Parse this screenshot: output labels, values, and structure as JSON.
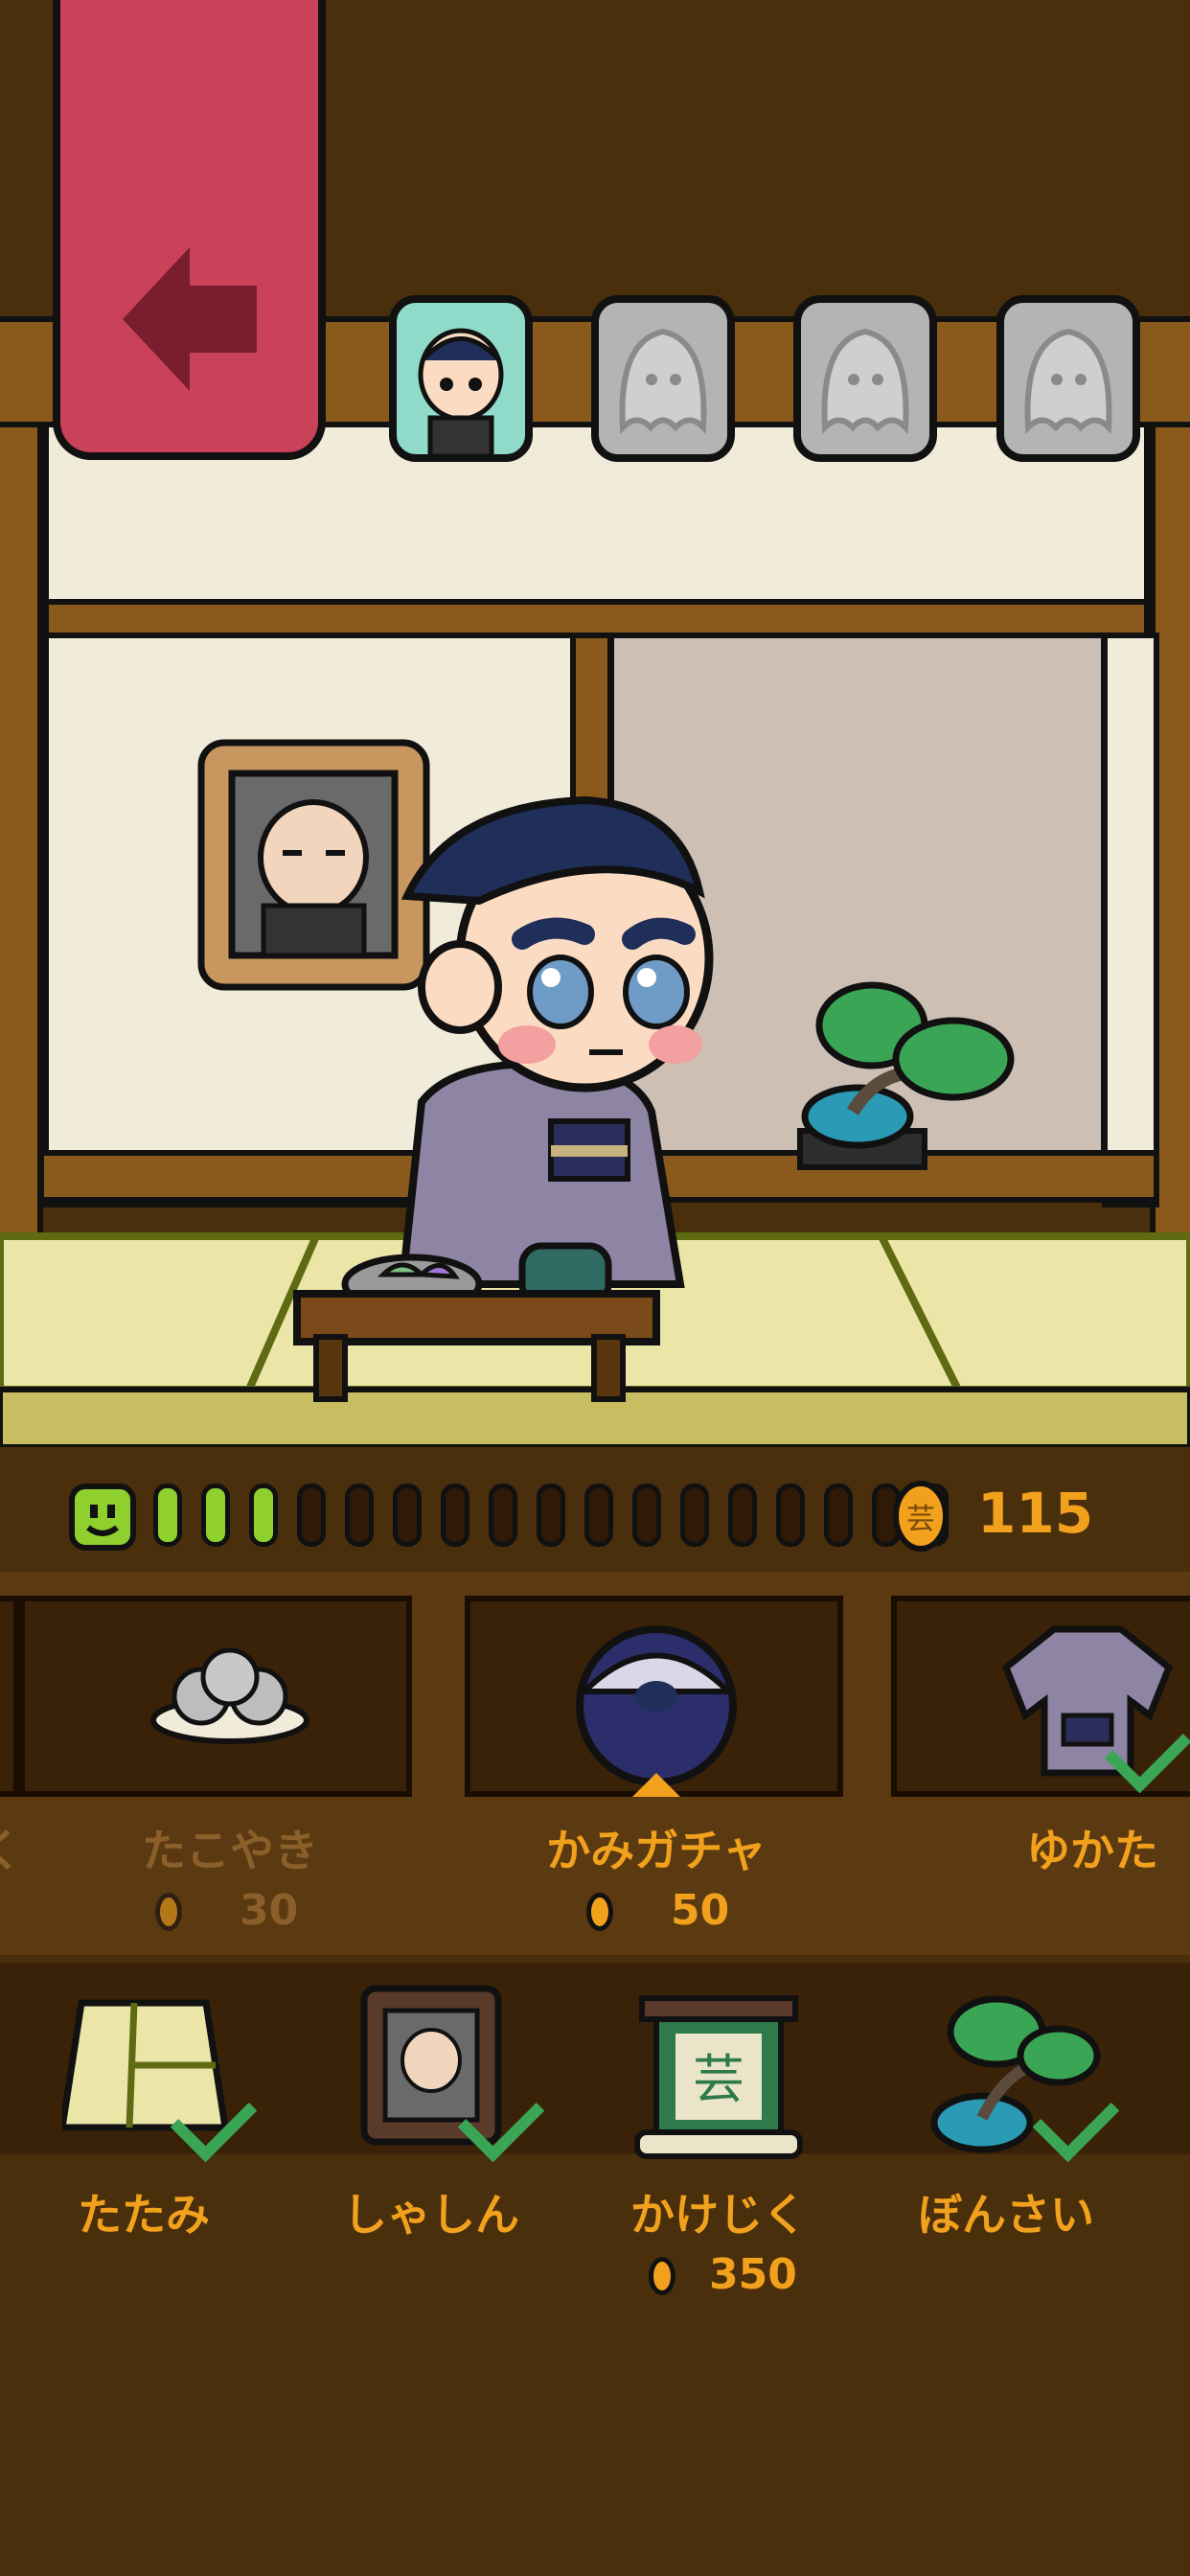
{
  "back_button": {
    "label": "",
    "icon": "arrow-left-icon"
  },
  "character_tabs": [
    {
      "name": "samurai-character",
      "state": "selected"
    },
    {
      "name": "ghost-character-1",
      "state": "locked"
    },
    {
      "name": "ghost-character-2",
      "state": "locked"
    },
    {
      "name": "ghost-character-3",
      "state": "locked"
    }
  ],
  "status": {
    "mood_icon": "smiley-face-icon",
    "meter_filled": 3,
    "meter_total": 17,
    "coins": "115"
  },
  "shop_items": [
    {
      "label": "たこやき",
      "price": "30",
      "state": "dimmed",
      "icon": "takoyaki-plate-icon"
    },
    {
      "label": "かみガチャ",
      "price": "50",
      "state": "selected",
      "icon": "hair-gacha-capsule-icon"
    },
    {
      "label": "ゆかた",
      "price": "",
      "state": "owned",
      "icon": "yukata-icon"
    }
  ],
  "furniture": [
    {
      "label": "たたみ",
      "price": "",
      "owned": true,
      "icon": "tatami-icon"
    },
    {
      "label": "しゃしん",
      "price": "",
      "owned": true,
      "icon": "photo-frame-icon"
    },
    {
      "label": "かけじく",
      "price": "350",
      "owned": false,
      "icon": "hanging-scroll-icon",
      "scroll_text": "芸"
    },
    {
      "label": "ぼんさい",
      "price": "",
      "owned": true,
      "icon": "bonsai-icon"
    }
  ],
  "colors": {
    "accent": "#f2a11c",
    "check": "#3aa655",
    "back_button": "#c94259",
    "meter_on": "#8fd02e",
    "tab_active": "#8fdac9"
  }
}
